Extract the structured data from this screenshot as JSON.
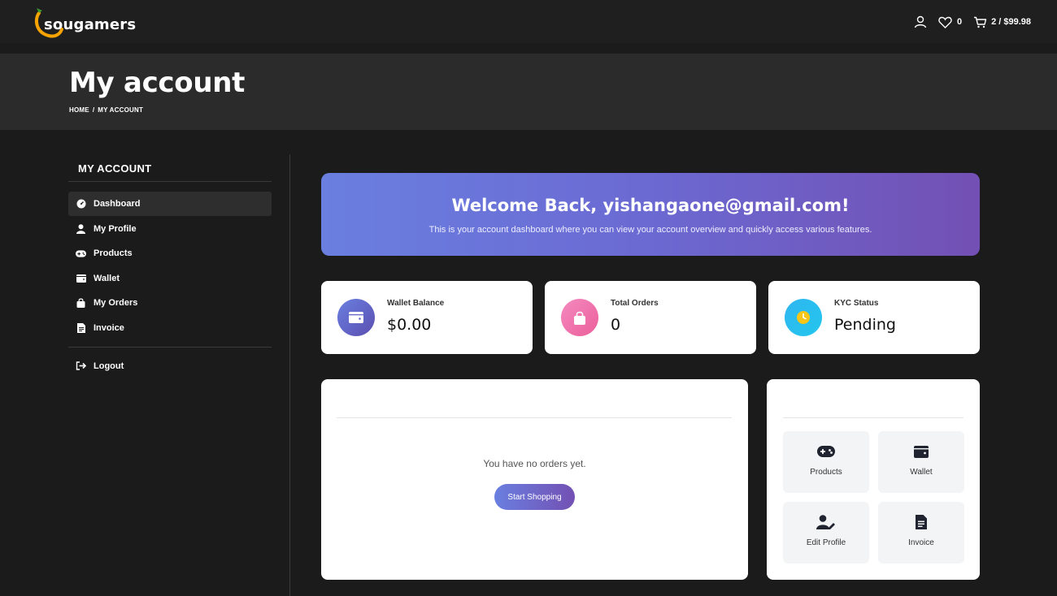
{
  "brand": {
    "name": "sougamers"
  },
  "header": {
    "wishlist_count": "0",
    "cart_summary": "2 / $99.98"
  },
  "page": {
    "title": "My account",
    "breadcrumb": [
      "HOME",
      "/",
      "MY ACCOUNT"
    ]
  },
  "sidebar": {
    "heading": "MY ACCOUNT",
    "items": [
      {
        "label": "Dashboard",
        "icon": "dashboard-icon",
        "active": true
      },
      {
        "label": "My Profile",
        "icon": "user-icon"
      },
      {
        "label": "Products",
        "icon": "gamepad-icon"
      },
      {
        "label": "Wallet",
        "icon": "wallet-icon"
      },
      {
        "label": "My Orders",
        "icon": "bag-icon"
      },
      {
        "label": "Invoice",
        "icon": "invoice-icon"
      }
    ],
    "logout": "Logout"
  },
  "welcome": {
    "title": "Welcome Back, yishangaone@gmail.com!",
    "subtitle": "This is your account dashboard where you can view your account overview and quickly access various features."
  },
  "stats": [
    {
      "label": "Wallet Balance",
      "value": "$0.00",
      "icon": "wallet-icon",
      "color": "#5b4fb0"
    },
    {
      "label": "Total Orders",
      "value": "0",
      "icon": "bag-icon",
      "color": "#ec5f9a"
    },
    {
      "label": "KYC Status",
      "value": "Pending",
      "icon": "clock-icon",
      "color": "#2fb6f0"
    }
  ],
  "orders": {
    "empty_text": "You have no orders yet.",
    "cta": "Start Shopping"
  },
  "quick_links": [
    {
      "label": "Products",
      "icon": "gamepad-icon"
    },
    {
      "label": "Wallet",
      "icon": "wallet-icon"
    },
    {
      "label": "Edit Profile",
      "icon": "user-edit-icon"
    },
    {
      "label": "Invoice",
      "icon": "invoice-icon"
    }
  ],
  "colors": {
    "background": "#1b1b1b",
    "accent_gradient_start": "#6a7fe0",
    "accent_gradient_end": "#7350b3"
  }
}
